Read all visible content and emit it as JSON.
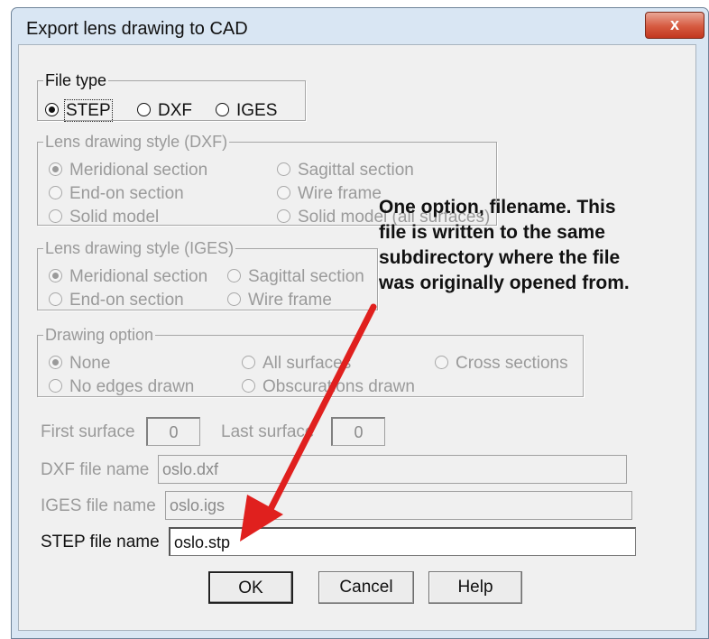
{
  "window": {
    "title": "Export lens drawing to CAD",
    "close_symbol": "x"
  },
  "file_type": {
    "legend": "File type",
    "options": [
      {
        "label": "STEP",
        "selected": true
      },
      {
        "label": "DXF",
        "selected": false
      },
      {
        "label": "IGES",
        "selected": false
      }
    ]
  },
  "dxf_style": {
    "legend": "Lens drawing style (DXF)",
    "options": [
      {
        "label": "Meridional section",
        "selected": true
      },
      {
        "label": "Sagittal section",
        "selected": false
      },
      {
        "label": "End-on section",
        "selected": false
      },
      {
        "label": "Wire frame",
        "selected": false
      },
      {
        "label": "Solid model",
        "selected": false
      },
      {
        "label": "Solid model (all surfaces)",
        "selected": false
      }
    ]
  },
  "iges_style": {
    "legend": "Lens drawing style (IGES)",
    "options": [
      {
        "label": "Meridional section",
        "selected": true
      },
      {
        "label": "Sagittal section",
        "selected": false
      },
      {
        "label": "End-on section",
        "selected": false
      },
      {
        "label": "Wire frame",
        "selected": false
      }
    ]
  },
  "drawing_option": {
    "legend": "Drawing option",
    "options": [
      {
        "label": "None",
        "selected": true
      },
      {
        "label": "All surfaces",
        "selected": false
      },
      {
        "label": "Cross sections",
        "selected": false
      },
      {
        "label": "No edges drawn",
        "selected": false
      },
      {
        "label": "Obscurations drawn",
        "selected": false
      }
    ]
  },
  "surfaces": {
    "first_label": "First surface",
    "first_value": "0",
    "last_label": "Last surface",
    "last_value": "0"
  },
  "dxf_file": {
    "label": "DXF file name",
    "value": "oslo.dxf"
  },
  "iges_file": {
    "label": "IGES file name",
    "value": "oslo.igs"
  },
  "step_file": {
    "label": "STEP file name",
    "value": "oslo.stp"
  },
  "buttons": {
    "ok": "OK",
    "cancel": "Cancel",
    "help": "Help"
  },
  "annotation": {
    "lines": [
      "One option, filename. This",
      "file is written to the same",
      "subdirectory where the file",
      "was originally opened from."
    ],
    "arrow_color": "#e0201e"
  }
}
